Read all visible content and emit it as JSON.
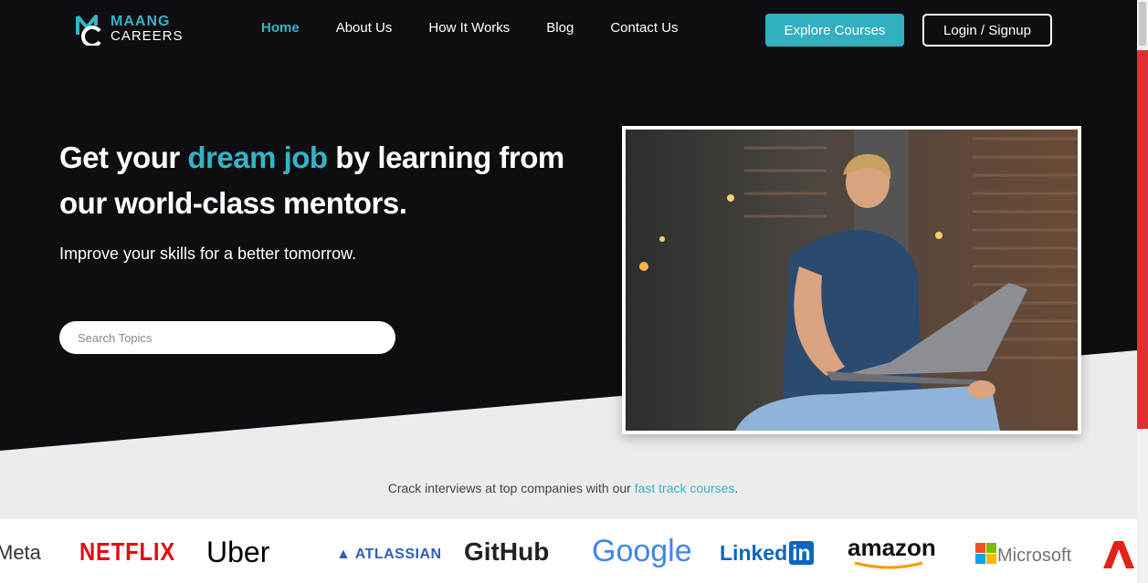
{
  "brand": {
    "line1": "MAANG",
    "line2": "CAREERS"
  },
  "nav": {
    "items": [
      {
        "label": "Home",
        "active": true
      },
      {
        "label": "About Us",
        "active": false
      },
      {
        "label": "How It Works",
        "active": false
      },
      {
        "label": "Blog",
        "active": false
      },
      {
        "label": "Contact Us",
        "active": false
      }
    ]
  },
  "header": {
    "explore_label": "Explore Courses",
    "login_label": "Login / Signup"
  },
  "hero": {
    "headline_part1": "Get your ",
    "headline_accent": "dream job",
    "headline_part2": " by learning from our world-class mentors.",
    "subheading": "Improve your skills for a better tomorrow.",
    "search_placeholder": "Search Topics"
  },
  "tagline": {
    "text": "Crack interviews at top companies with our ",
    "link": "fast track courses",
    "end": "."
  },
  "companies": [
    {
      "name": "Meta"
    },
    {
      "name": "NETFLIX"
    },
    {
      "name": "Uber"
    },
    {
      "name": "ATLASSIAN"
    },
    {
      "name": "GitHub"
    },
    {
      "name": "Google"
    },
    {
      "name": "Linked",
      "badge": "in"
    },
    {
      "name": "amazon"
    },
    {
      "name": "Microsoft"
    }
  ],
  "colors": {
    "accent": "#35b3c4",
    "hero_bg": "#0e0e12",
    "netflix_red": "#e50914",
    "linkedin_blue": "#0a66c2"
  }
}
